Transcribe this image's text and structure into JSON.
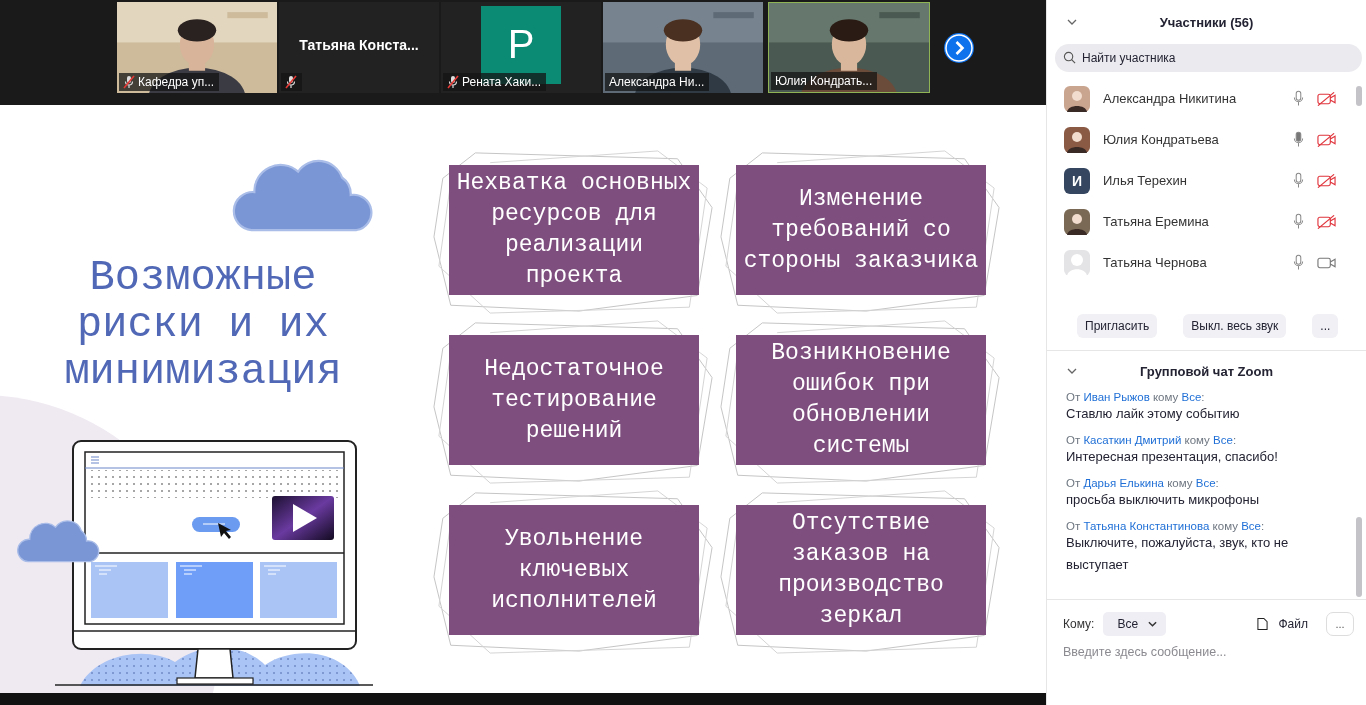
{
  "video_strip": {
    "tiles": [
      {
        "kind": "video",
        "label": "Кафедра уп...",
        "muted": true,
        "active": false
      },
      {
        "kind": "name",
        "name": "Татьяна Конста...",
        "muted": true,
        "active": false
      },
      {
        "kind": "letter",
        "letter": "Р",
        "label": "Рената Хаки...",
        "muted": true,
        "active": false
      },
      {
        "kind": "video",
        "label": "Александра Ни...",
        "muted": false,
        "active": false
      },
      {
        "kind": "video",
        "label": "Юлия Кондрать...",
        "muted": false,
        "active": true
      }
    ]
  },
  "slide": {
    "title": "Возможные\nриски и их\nминимизация",
    "cards": [
      "Нехватка основных ресурсов для реализации проекта",
      "Изменение требований со стороны заказчика",
      "Недостаточное тестирование решений",
      "Возникновение ошибок при обновлении системы",
      "Увольнение ключевых исполнителей",
      "Отсутствие заказов на производство зеркал"
    ]
  },
  "participants": {
    "title": "Участники (56)",
    "search": {
      "placeholder": "Найти участника"
    },
    "items": [
      {
        "name": "Александра Никитина",
        "speaking": false,
        "video_off": true
      },
      {
        "name": "Юлия Кондратьева",
        "speaking": true,
        "video_off": true
      },
      {
        "name": "Илья Терехин",
        "avatar": {
          "kind": "letter",
          "letter": "И"
        },
        "speaking": false,
        "video_off": true
      },
      {
        "name": "Татьяна Еремина",
        "speaking": false,
        "video_off": true
      },
      {
        "name": "Татьяна Чернова",
        "avatar": {
          "kind": "blank"
        },
        "speaking": false,
        "video_off": false
      }
    ],
    "buttons": [
      "Пригласить",
      "Выкл. весь звук",
      "..."
    ]
  },
  "chat": {
    "title": "Групповой чат Zoom",
    "messages": [
      {
        "from_word": "От",
        "sender": "Иван Рыжов",
        "to_word": "кому",
        "recipient": "Все",
        "colon": ":",
        "text": "Ставлю лайк этому событию"
      },
      {
        "from_word": "От",
        "sender": "Касаткин Дмитрий",
        "to_word": "кому",
        "recipient": "Все",
        "colon": ":",
        "text": "Интересная презентация, спасибо!"
      },
      {
        "from_word": "От",
        "sender": "Дарья Елькина",
        "to_word": "кому",
        "recipient": "Все",
        "colon": ":",
        "text": "просьба выключить микрофоны"
      },
      {
        "from_word": "От",
        "sender": "Татьяна Константинова",
        "to_word": "кому",
        "recipient": "Все",
        "colon": ":",
        "text": "Выключите, пожалуйста, звук, кто не выступает"
      }
    ],
    "to_label": "Кому:",
    "recipient": "Все",
    "file_label": "Файл",
    "more": "...",
    "input": {
      "placeholder": "Введите здесь сообщение..."
    }
  }
}
